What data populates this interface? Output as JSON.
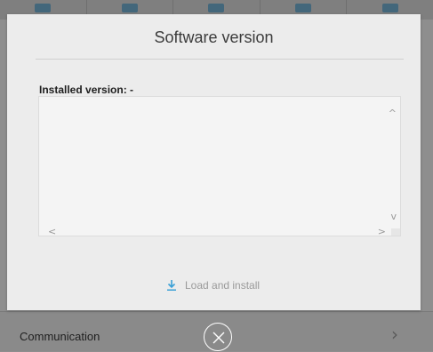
{
  "dialog": {
    "title": "Software version",
    "installed_label": "Installed version: -",
    "version_details": "",
    "load_button_label": "Load and install"
  },
  "background": {
    "row_label": "Communication"
  },
  "colors": {
    "dialog_bg": "#ececec",
    "accent_icon": "#3aa0d6",
    "disabled_text": "#9a9a9a"
  },
  "icons": {
    "load": "download-icon",
    "close": "close-icon",
    "row_chevron": "chevron-right-icon"
  }
}
